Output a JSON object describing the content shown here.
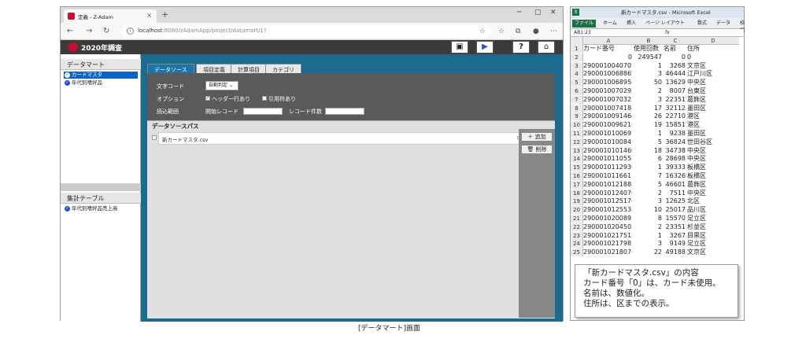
{
  "browser": {
    "tab_title": "定義 - Z-Adam",
    "url_host": "localhost",
    "url_rest": ":8080/zAdamApp/project/datamart/1?"
  },
  "app": {
    "title": "2020年調査",
    "toolbar_icons": [
      "save-icon",
      "play-icon",
      "help-icon",
      "home-icon"
    ]
  },
  "sidebar": {
    "datamart_header": "データマート",
    "datamart_items": [
      {
        "label": "カードマスタ",
        "selected": true
      },
      {
        "label": "年代別嗜好品",
        "selected": false
      }
    ],
    "agg_header": "集計テーブル",
    "agg_items": [
      {
        "label": "年代別嗜好品売上高"
      }
    ]
  },
  "tabs": [
    "データソース",
    "項目定義",
    "計算項目",
    "カテゴリ"
  ],
  "form": {
    "charcode_label": "文字コード",
    "charcode_value": "自動判定",
    "option_label": "オプション",
    "header_row": "ヘッダー行あり",
    "header_row_checked": true,
    "quoted": "引用符あり",
    "quoted_checked": false,
    "range_label": "読込範囲",
    "start_label": "開始レコード",
    "count_label": "レコード件数"
  },
  "datasource": {
    "header": "データソースパス",
    "file": "新カードマスタ.csv",
    "add_label": "追加",
    "delete_label": "削除"
  },
  "caption": "[データマート]画面",
  "excel": {
    "title": "新カードマスタ.csv - Microsoft Excel",
    "ribbon": [
      "ファイル",
      "ホーム",
      "挿入",
      "ページ レイアウト",
      "数式",
      "データ",
      "校閲"
    ],
    "cell_ref": "AB1:23",
    "columns": [
      "A",
      "B",
      "C",
      "D"
    ],
    "header_row": [
      "カード番号",
      "使用回数",
      "名前",
      "住所"
    ],
    "rows": [
      [
        "0",
        "249547",
        "0",
        "0"
      ],
      [
        "2900010040707",
        "1",
        "3268",
        "文京区"
      ],
      [
        "2900010068862",
        "3",
        "46444",
        "江戸川区"
      ],
      [
        "2900010068954",
        "50",
        "13629",
        "中央区"
      ],
      [
        "2900010070292",
        "2",
        "8007",
        "台東区"
      ],
      [
        "2900010070322",
        "3",
        "22351",
        "葛飾区"
      ],
      [
        "2900010074184",
        "17",
        "32112",
        "墨田区"
      ],
      [
        "2900010091464",
        "26",
        "22710",
        "港区"
      ],
      [
        "2900010096216",
        "19",
        "15851",
        "港区"
      ],
      [
        "2900010100692",
        "1",
        "9238",
        "墨田区"
      ],
      [
        "2900010100845",
        "5",
        "36824",
        "世田谷区"
      ],
      [
        "2900010101460",
        "18",
        "34738",
        "中央区"
      ],
      [
        "2900010110554",
        "6",
        "28698",
        "中央区"
      ],
      [
        "2900010112930",
        "1",
        "39333",
        "板橋区"
      ],
      [
        "2900010116617",
        "7",
        "16326",
        "板橋区"
      ],
      [
        "2900010121888",
        "5",
        "46601",
        "葛飾区"
      ],
      [
        "2900010124070",
        "2",
        "7511",
        "中央区"
      ],
      [
        "2900010125176",
        "3",
        "12625",
        "北区"
      ],
      [
        "2900010125534",
        "10",
        "25017",
        "品川区"
      ],
      [
        "2900010200897",
        "8",
        "15570",
        "足立区"
      ],
      [
        "2900010204505",
        "2",
        "23351",
        "杉並区"
      ],
      [
        "2900010217512",
        "1",
        "3267",
        "目黒区"
      ],
      [
        "2900010217987",
        "3",
        "9149",
        "足立区"
      ],
      [
        "2900010218076",
        "22",
        "49188",
        "文京区"
      ]
    ]
  },
  "note": {
    "lines": [
      "「新カードマスタ.csv」の内容",
      "カード番号「0」は、カード未使用。",
      "名前は、数値化。",
      "住所は、区までの表示。"
    ]
  }
}
